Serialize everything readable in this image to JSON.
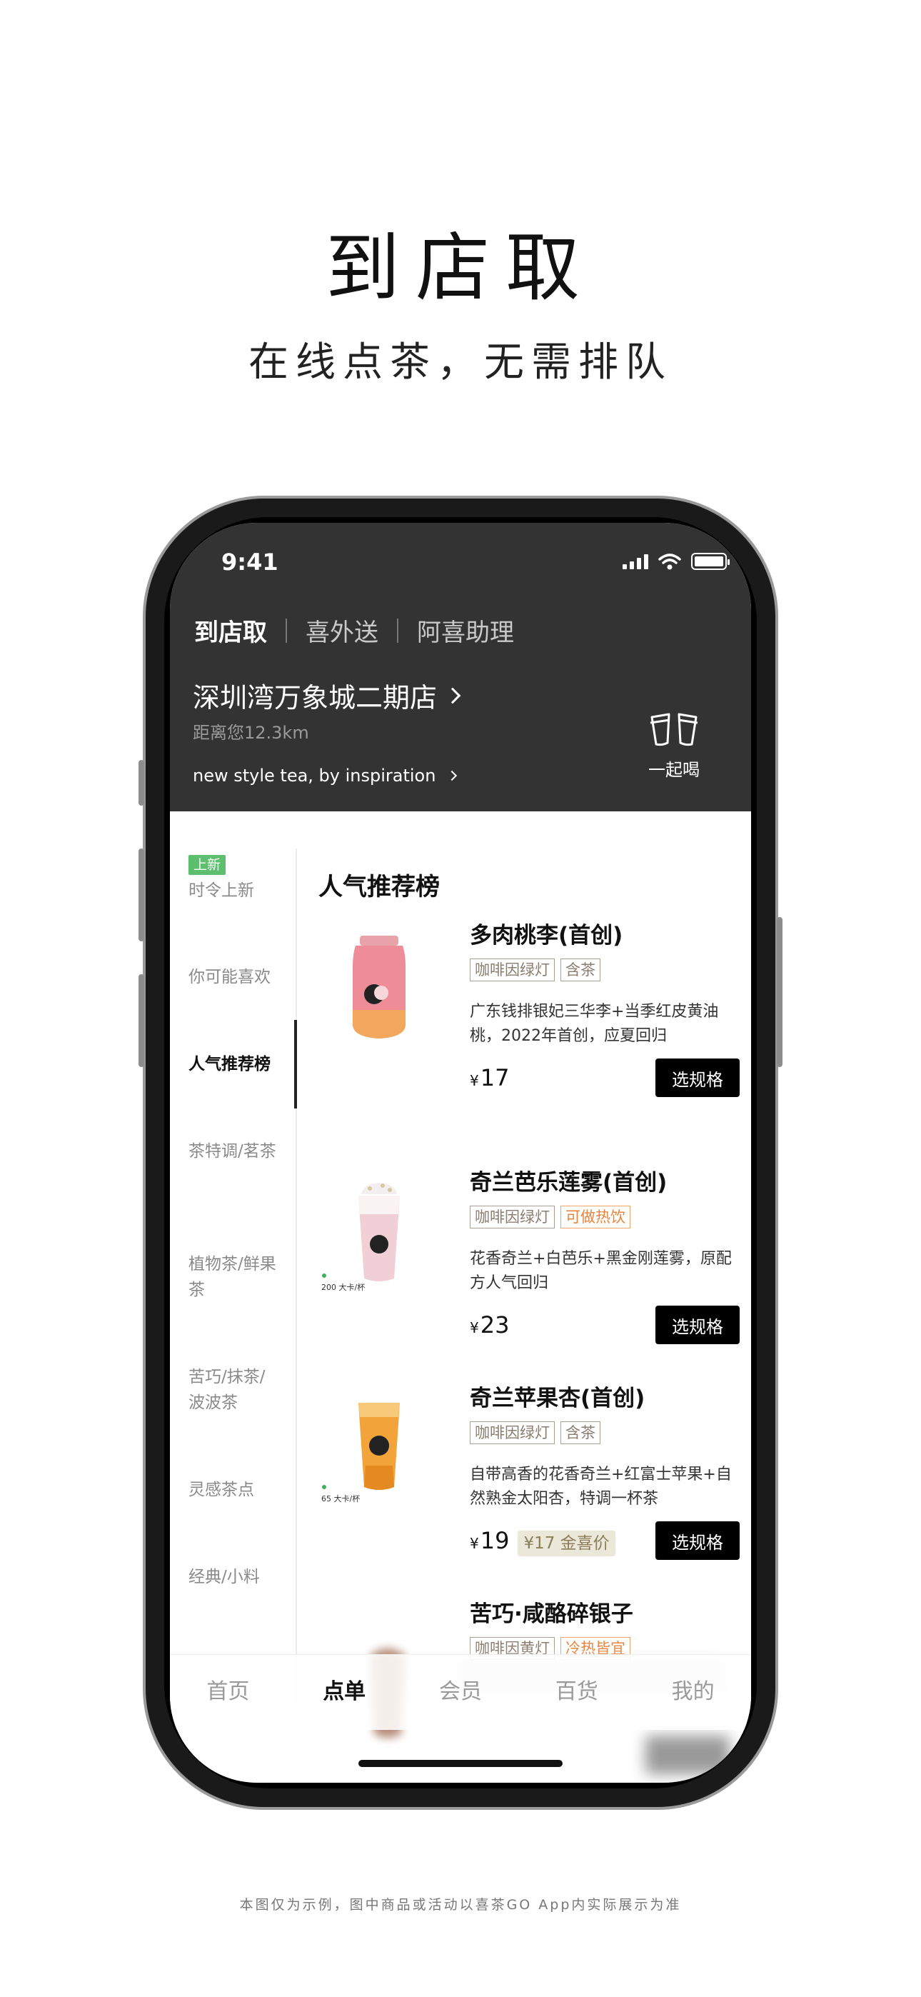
{
  "hero": {
    "title": "到店取",
    "subtitle": "在线点茶，无需排队"
  },
  "status_bar": {
    "time": "9:41"
  },
  "header": {
    "tabs": [
      {
        "label": "到店取",
        "active": true
      },
      {
        "label": "喜外送",
        "active": false
      },
      {
        "label": "阿喜助理",
        "active": false
      }
    ],
    "store_name": "深圳湾万象城二期店",
    "distance": "距离您12.3km",
    "slogan": "new style tea, by inspiration",
    "together_label": "一起喝"
  },
  "side_nav": {
    "new_badge": "上新",
    "items": [
      {
        "label": "时令上新",
        "active": false
      },
      {
        "label": "你可能喜欢",
        "active": false
      },
      {
        "label": "人气推荐榜",
        "active": true
      },
      {
        "label": "茶特调/茗茶",
        "active": false
      },
      {
        "label": "植物茶/鲜果茶",
        "active": false
      },
      {
        "label": "苦巧/抹茶/波波茶",
        "active": false
      },
      {
        "label": "灵感茶点",
        "active": false
      },
      {
        "label": "经典/小料",
        "active": false
      }
    ]
  },
  "section_title": "人气推荐榜",
  "products": [
    {
      "name": "多肉桃李(首创)",
      "tags": [
        "咖啡因绿灯",
        "含茶"
      ],
      "description": "广东钱排银妃三华李+当季红皮黄油桃，2022年首创，应夏回归",
      "currency": "¥",
      "price": "17",
      "member_price": "",
      "button": "选规格"
    },
    {
      "name": "奇兰芭乐莲雾(首创)",
      "tags": [
        "咖啡因绿灯",
        "可做热饮"
      ],
      "description": "花香奇兰+白芭乐+黑金刚莲雾，原配方人气回归",
      "currency": "¥",
      "price": "23",
      "member_price": "",
      "button": "选规格"
    },
    {
      "name": "奇兰苹果杏(首创)",
      "tags": [
        "咖啡因绿灯",
        "含茶"
      ],
      "description": "自带高香的花香奇兰+红富士苹果+自然熟金太阳杏，特调一杯茶",
      "currency": "¥",
      "price": "19",
      "member_price": "¥17 金喜价",
      "button": "选规格"
    },
    {
      "name": "苦巧·咸酪碎银子",
      "tags": [
        "咖啡因黄灯",
        "冷热皆宜"
      ]
    }
  ],
  "cup_labels": {
    "p2": "200 大卡/杯",
    "p3": "65 大卡/杯"
  },
  "tabbar": [
    {
      "label": "首页",
      "active": false
    },
    {
      "label": "点单",
      "active": true
    },
    {
      "label": "会员",
      "active": false
    },
    {
      "label": "百货",
      "active": false
    },
    {
      "label": "我的",
      "active": false
    }
  ],
  "footnote": "本图仅为示例，图中商品或活动以喜茶GO App内实际展示为准",
  "colors": {
    "header_bg": "#333333",
    "accent_black": "#000000",
    "new_badge": "#5dbe6e",
    "hot_tag": "#e8843d"
  }
}
